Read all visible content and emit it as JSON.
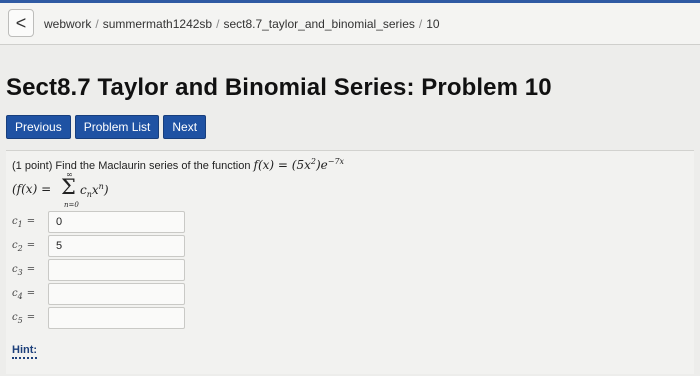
{
  "breadcrumb": {
    "back_glyph": "<",
    "items": [
      "webwork",
      "summermath1242sb",
      "sect8.7_taylor_and_binomial_series",
      "10"
    ]
  },
  "page_title": "Sect8.7 Taylor and Binomial Series: Problem 10",
  "nav": {
    "previous": "Previous",
    "problem_list": "Problem List",
    "next": "Next",
    "accent_color": "#1f52a3"
  },
  "problem": {
    "points": "(1 point)",
    "statement": "Find the Maclaurin series of the function",
    "function_lhs": "f(x) = (5x",
    "function_exp2": "2",
    "function_mid": ")e",
    "function_exp": "−7x",
    "series_lhs": "(f(x) =",
    "series_upper": "∞",
    "series_sigma": "Σ",
    "series_lower": "n=0",
    "series_term": "c",
    "series_term_sub": "n",
    "series_term_x": "x",
    "series_term_sup": "n",
    "series_close": ")"
  },
  "answers": [
    {
      "label": "c",
      "sub": "1",
      "eq": "=",
      "value": "0"
    },
    {
      "label": "c",
      "sub": "2",
      "eq": "=",
      "value": "5"
    },
    {
      "label": "c",
      "sub": "3",
      "eq": "=",
      "value": ""
    },
    {
      "label": "c",
      "sub": "4",
      "eq": "=",
      "value": ""
    },
    {
      "label": "c",
      "sub": "5",
      "eq": "=",
      "value": ""
    }
  ],
  "hint": "Hint:"
}
